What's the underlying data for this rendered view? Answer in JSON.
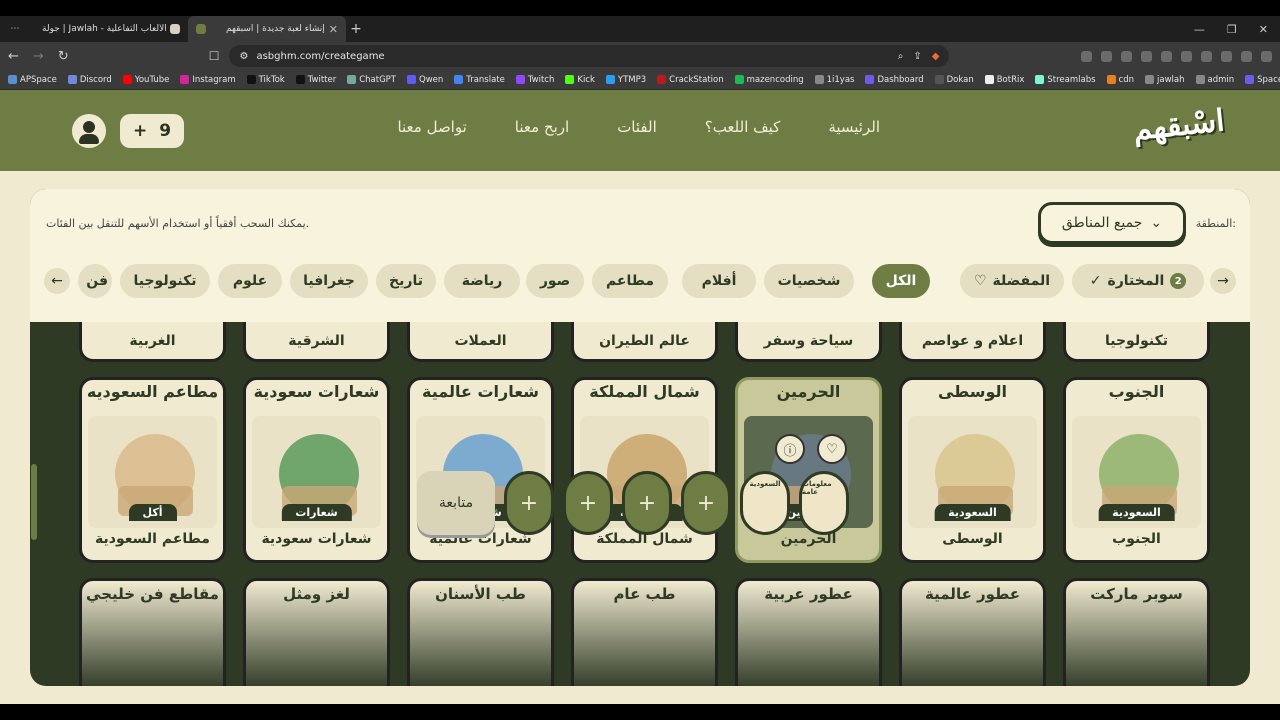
{
  "browser": {
    "tabs": [
      {
        "title": "جولة | Jawlah - منصة الألعاب التفاعلية",
        "active": false
      },
      {
        "title": "إنشاء لعبة جديدة | اسبقهم",
        "active": true
      }
    ],
    "url": "asbghm.com/creategame",
    "bookmarks": [
      "APSpace",
      "Discord",
      "YouTube",
      "Instagram",
      "TikTok",
      "Twitter",
      "ChatGPT",
      "Qwen",
      "Translate",
      "Twitch",
      "Kick",
      "YTMP3",
      "CrackStation",
      "mazencoding",
      "1i1yas",
      "Dashboard",
      "Dokan",
      "BotRix",
      "Streamlabs",
      "cdn",
      "jawlah",
      "admin",
      "Spacemail"
    ],
    "bookmark_colors": [
      "#5a8fd0",
      "#7289da",
      "#ff0000",
      "#d6249f",
      "#111111",
      "#111111",
      "#74aa9c",
      "#615ced",
      "#4285f4",
      "#9146ff",
      "#53fc18",
      "#2a9df4",
      "#b71c1c",
      "#1db954",
      "#888888",
      "#6c5ce7",
      "#555555",
      "#eeeeee",
      "#80f5d2",
      "#e67e22",
      "#888888",
      "#888888",
      "#6c5ce7"
    ]
  },
  "header": {
    "logo": "اسْبقهم",
    "menu": [
      "الرئيسية",
      "كيف اللعب؟",
      "الفئات",
      "اربح معنا",
      "تواصل معنا"
    ],
    "points": "9",
    "points_plus": "+"
  },
  "filters": {
    "region_label": "المنطقة:",
    "region_value": "جميع المناطق",
    "hint": "يمكنك السحب أفقياً أو استخدام الأسهم للتنقل بين الفئات.",
    "chips": [
      "المختارة",
      "المفضلة",
      "الكل",
      "شخصيات",
      "أفلام",
      "مطاعم",
      "صور",
      "رياضة",
      "تاريخ",
      "جغرافيا",
      "علوم",
      "تكنولوجيا",
      "فن"
    ],
    "selected_count": "2",
    "active_chip": "الكل"
  },
  "top_row": [
    "تكنولوجيا",
    "اعلام و عواصم",
    "سياحة وسفر",
    "عالم الطيران",
    "العملات",
    "الشرقية",
    "الغربية"
  ],
  "cards": [
    {
      "title": "الجنوب",
      "tag": "السعودية",
      "name": "الجنوب",
      "selected": false
    },
    {
      "title": "الوسطى",
      "tag": "السعودية",
      "name": "الوسطى",
      "selected": false
    },
    {
      "title": "الحرمين",
      "tag": "الحرمين",
      "name": "الحرمين",
      "selected": true
    },
    {
      "title": "شمال المملكة",
      "tag": "السعودية",
      "name": "شمال المملكة",
      "selected": false
    },
    {
      "title": "شعارات عالمية",
      "tag": "شعارات",
      "name": "شعارات عالمية",
      "selected": false
    },
    {
      "title": "شعارات سعودية",
      "tag": "شعارات",
      "name": "شعارات سعودية",
      "selected": false
    },
    {
      "title": "مطاعم السعوديه",
      "tag": "أكل",
      "name": "مطاعم السعودية",
      "selected": false
    }
  ],
  "bottom_row": [
    "سوبر ماركت",
    "عطور عالمية",
    "عطور عربية",
    "طب عام",
    "طب الأسنان",
    "لغز ومثل",
    "مقاطع فن خليجي"
  ],
  "dock": {
    "continue_label": "متابعة",
    "empty_slot": "+",
    "chosen": [
      "السعودية",
      "معلومات عامة"
    ]
  }
}
